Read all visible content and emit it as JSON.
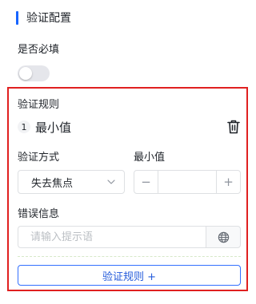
{
  "section": {
    "title": "验证配置"
  },
  "required": {
    "label": "是否必填",
    "enabled": false
  },
  "rules": {
    "title": "验证规则",
    "items": [
      {
        "index": "1",
        "name": "最小值",
        "method_label": "验证方式",
        "method_value": "失去焦点",
        "min_label": "最小值",
        "min_value": "",
        "minus": "−",
        "plus": "+",
        "message_label": "错误信息",
        "message_placeholder": "请输入提示语"
      }
    ],
    "add_button": "验证规则 +"
  },
  "colors": {
    "accent": "#1664ff",
    "highlight_border": "#e02020"
  }
}
